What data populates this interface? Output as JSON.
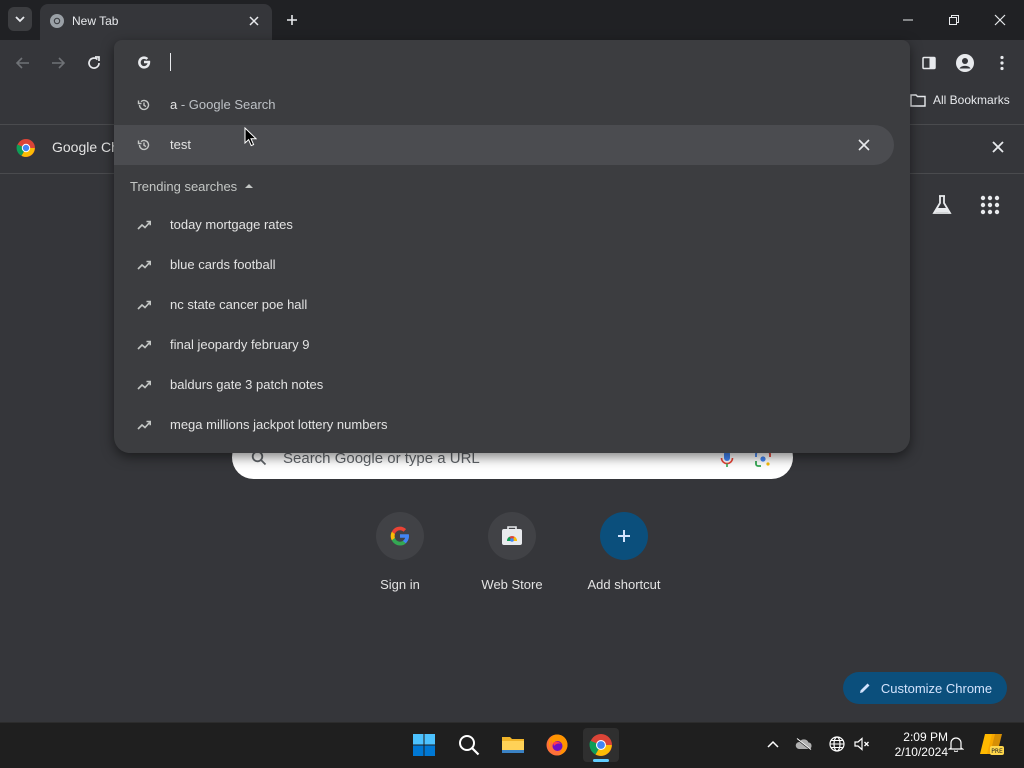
{
  "tab": {
    "title": "New Tab"
  },
  "bookmarks": {
    "all_label": "All Bookmarks"
  },
  "infobar": {
    "text": "Google Ch"
  },
  "omnibox": {
    "suggestions": [
      {
        "query": "a",
        "suffix": " - Google Search",
        "icon": "history-icon"
      },
      {
        "query": "test",
        "suffix": "",
        "icon": "history-icon"
      }
    ],
    "trending_header": "Trending searches",
    "trending": [
      "today mortgage rates",
      "blue cards football",
      "nc state cancer poe hall",
      "final jeopardy february 9",
      "baldurs gate 3 patch notes",
      "mega millions jackpot lottery numbers"
    ]
  },
  "ntp": {
    "search_placeholder": "Search Google or type a URL",
    "shortcuts": [
      {
        "label": "Sign in"
      },
      {
        "label": "Web Store"
      },
      {
        "label": "Add shortcut"
      }
    ],
    "customize_label": "Customize Chrome"
  },
  "taskbar": {
    "time": "2:09 PM",
    "date": "2/10/2024",
    "apps": [
      "start-icon",
      "search-icon",
      "file-explorer-icon",
      "firefox-icon",
      "chrome-icon"
    ]
  },
  "colors": {
    "background": "#35363a",
    "omnibox": "#3c3d40",
    "accent": "#0b4f7c",
    "titlebar": "#202124"
  }
}
